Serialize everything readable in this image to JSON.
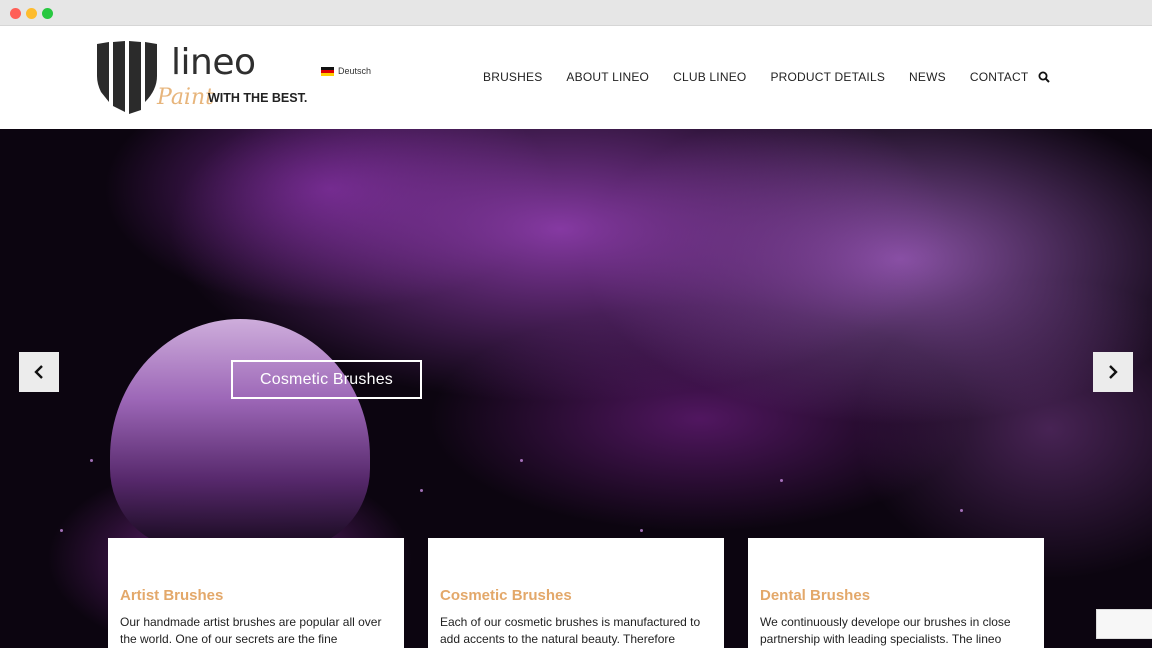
{
  "colors": {
    "accent": "#e3a86a",
    "hero_bg": "#0c0510",
    "text": "#222222"
  },
  "brand": {
    "name": "lineo",
    "paint": "Paint",
    "tagline": "WITH THE BEST."
  },
  "language": {
    "label": "Deutsch"
  },
  "nav": {
    "items": [
      "BRUSHES",
      "ABOUT LINEO",
      "CLUB LINEO",
      "PRODUCT DETAILS",
      "NEWS",
      "CONTACT"
    ]
  },
  "hero": {
    "caption": "Cosmetic Brushes"
  },
  "cards": [
    {
      "title": "Artist Brushes",
      "text": "Our handmade artist brushes are popular all over the world. One of our secrets are the fine"
    },
    {
      "title": "Cosmetic Brushes",
      "text": "Each of our cosmetic brushes is manufactured to add accents to the natural beauty. Therefore"
    },
    {
      "title": "Dental Brushes",
      "text": "We continuously develope our brushes in close partnership with leading specialists. The lineo"
    }
  ]
}
